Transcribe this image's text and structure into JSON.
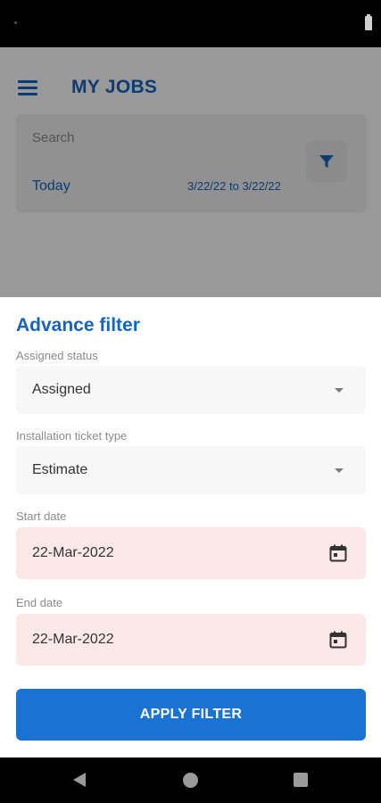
{
  "app_bar": {
    "title": "MY JOBS",
    "menu_icon": "hamburger-menu-icon"
  },
  "search": {
    "placeholder": "Search",
    "value": ""
  },
  "filter_summary": {
    "period_label": "Today",
    "date_range": "3/22/22 to 3/22/22",
    "filter_icon": "filter-funnel-icon"
  },
  "sheet": {
    "title": "Advance filter",
    "assigned_status": {
      "label": "Assigned status",
      "value": "Assigned"
    },
    "ticket_type": {
      "label": "Installation ticket type",
      "value": "Estimate"
    },
    "start_date": {
      "label": "Start date",
      "value": "22-Mar-2022"
    },
    "end_date": {
      "label": "End date",
      "value": "22-Mar-2022"
    },
    "apply_label": "APPLY FILTER"
  },
  "colors": {
    "brand_blue": "#1565c0",
    "button_blue": "#1a73d2",
    "date_field_bg": "#fde8e8",
    "select_field_bg": "#f7f7f7"
  }
}
